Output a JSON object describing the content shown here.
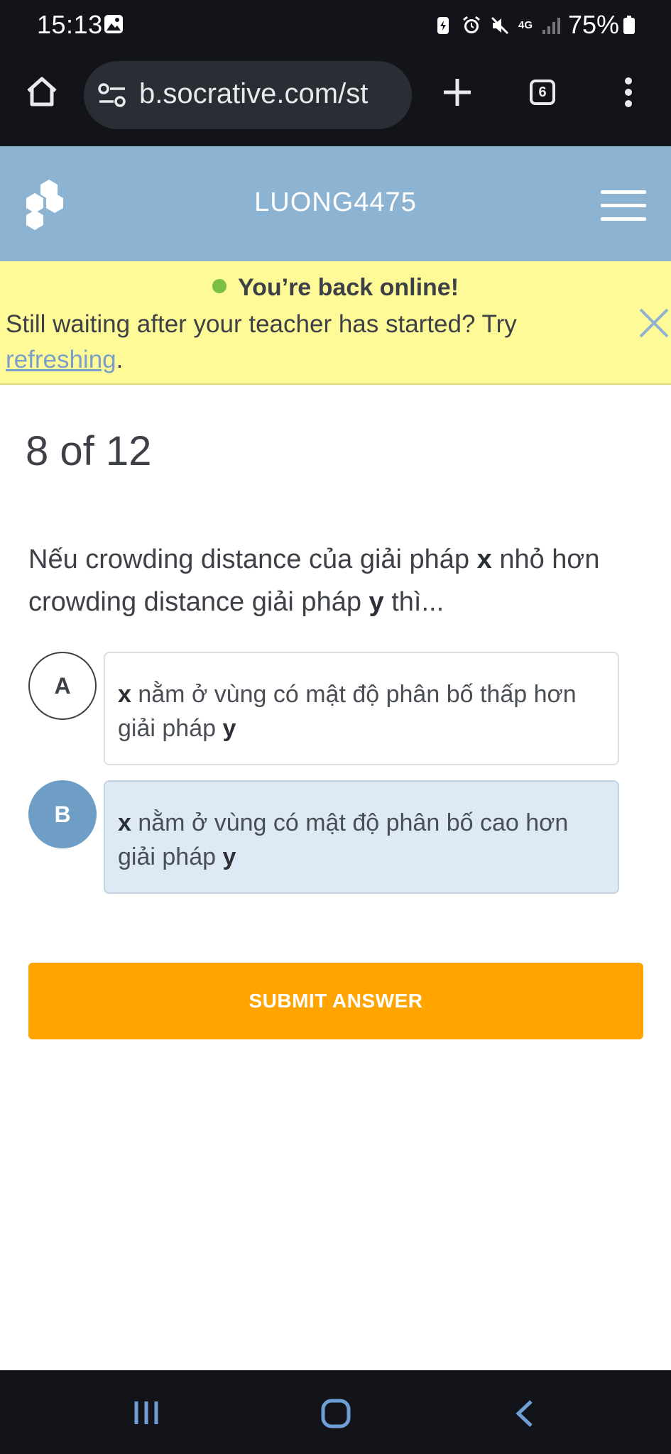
{
  "status_bar": {
    "time": "15:13",
    "network": "4G",
    "battery": "75%"
  },
  "browser": {
    "url": "b.socrative.com/st",
    "tab_count": "6"
  },
  "header": {
    "room_name": "LUONG4475"
  },
  "banner": {
    "title": "You’re back online!",
    "message": "Still waiting after your teacher has started? Try ",
    "link_text": "refreshing",
    "suffix": "."
  },
  "quiz": {
    "progress": "8 of 12",
    "question": {
      "part1": "Nếu crowding distance của giải pháp ",
      "var_x": "x",
      "part2": " nhỏ hơn crowding distance giải pháp ",
      "var_y": "y",
      "part3": " thì..."
    },
    "options": [
      {
        "letter": "A",
        "var_x": "x",
        "text": " nằm ở vùng có mật độ phân bố thấp hơn giải pháp ",
        "var_y": "y",
        "selected": false
      },
      {
        "letter": "B",
        "var_x": "x",
        "text": " nằm ở vùng có mật độ phân bố cao hơn giải pháp ",
        "var_y": "y",
        "selected": true
      }
    ],
    "submit_label": "SUBMIT ANSWER"
  },
  "colors": {
    "header_bg": "#8db3d3",
    "banner_bg": "#fefa97",
    "submit_bg": "#ffa401",
    "selected_option_bg": "#dde9f4",
    "selected_letter_bg": "#6e9dc6",
    "online_dot": "#7cbf45"
  }
}
